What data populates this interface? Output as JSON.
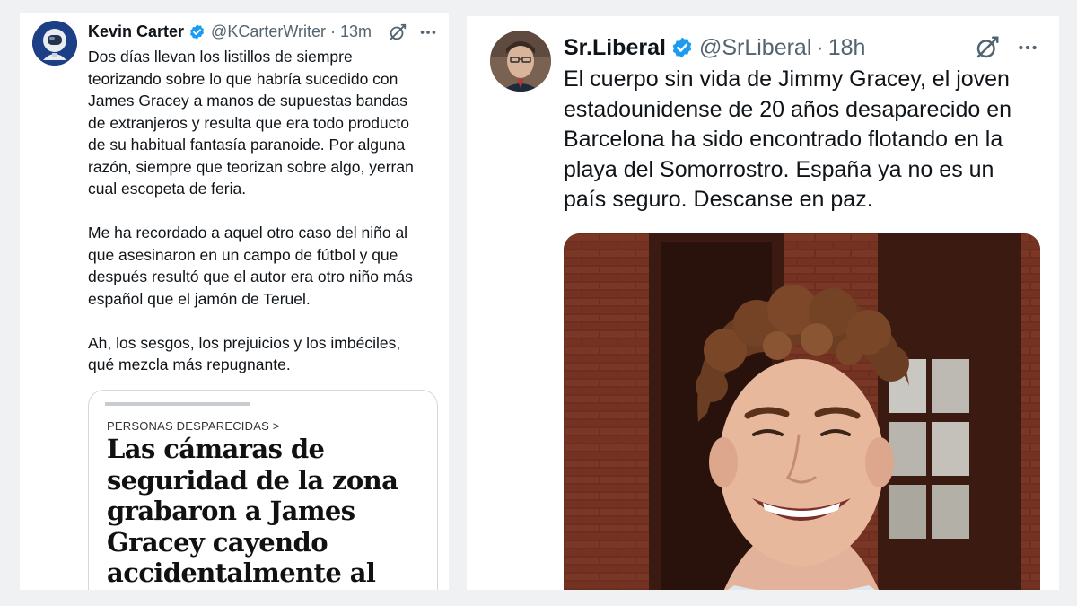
{
  "left_tweet": {
    "author": {
      "display_name": "Kevin Carter",
      "handle": "@KCarterWriter",
      "verified": true
    },
    "separator": "·",
    "time": "13m",
    "text": "Dos días llevan los listillos de siempre\nteorizando sobre lo que habría sucedido con\nJames Gracey a manos de supuestas bandas\nde extranjeros y resulta que era todo producto\nde su habitual fantasía paranoide. Por alguna\nrazón, siempre que teorizan sobre algo, yerran\ncual escopeta de feria.\n\nMe ha recordado a aquel otro caso del niño al\nque asesinaron en un campo de fútbol y que\ndespués resultó que el autor era otro niño más\nespañol que el jamón de Teruel.\n\nAh, los sesgos, los prejuicios y los imbéciles,\nqué mezcla más repugnante.",
    "article": {
      "kicker": "PERSONAS DESPARECIDAS >",
      "title": "Las cámaras de seguridad de la zona grabaron a James Gracey cayendo accidentalmente al mar"
    },
    "icons": {
      "avatar": "astronaut-avatar-icon",
      "verified": "verified-badge-icon",
      "grok": "grok-icon",
      "more": "more-options-icon"
    }
  },
  "right_tweet": {
    "author": {
      "display_name": "Sr.Liberal",
      "handle": "@SrLiberal",
      "verified": true
    },
    "separator": "·",
    "time": "18h",
    "text": "El cuerpo sin vida de Jimmy Gracey, el joven\nestadounidense de 20 años desaparecido en\nBarcelona ha sido encontrado flotando en la\nplaya del Somorrostro. España ya no es un\npaís seguro. Descanse en paz.",
    "media": "photo of a smiling young man with curly hair in front of a brick building",
    "icons": {
      "avatar": "profile-photo-avatar",
      "verified": "verified-badge-icon",
      "grok": "grok-icon",
      "more": "more-options-icon"
    }
  },
  "colors": {
    "background": "#f0f1f2",
    "card": "#ffffff",
    "text": "#0f1419",
    "secondary": "#536471",
    "verified_blue": "#1d9bf0",
    "border": "#cfd9de"
  }
}
